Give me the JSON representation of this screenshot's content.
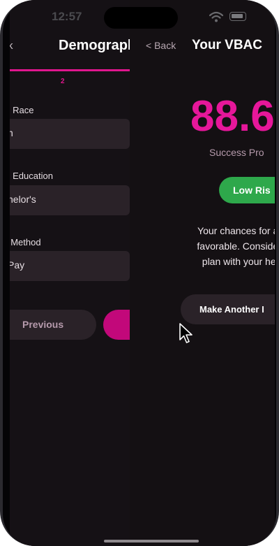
{
  "status_bar": {
    "time": "12:57"
  },
  "demographics_screen": {
    "back_label": "k",
    "title": "Demograpl",
    "step_number": "2",
    "fields": [
      {
        "label": "s Race",
        "value": "n"
      },
      {
        "label": "s Education",
        "value": "helor's"
      },
      {
        "label": "t Method",
        "value": "Pay"
      }
    ],
    "previous_label": "Previous"
  },
  "result_screen": {
    "back_label": "< Back",
    "title": "Your VBAC",
    "probability": "88.6",
    "probability_label": "Success Pro",
    "risk_label": "Low Ris",
    "risk_color": "#2ea84b",
    "message_lines": [
      "Your chances for a suc",
      "favorable. Consider dis",
      "plan with your health"
    ],
    "again_label": "Make Another I"
  },
  "colors": {
    "accent": "#e6179a",
    "background": "#141013",
    "surface": "#2a2228"
  }
}
